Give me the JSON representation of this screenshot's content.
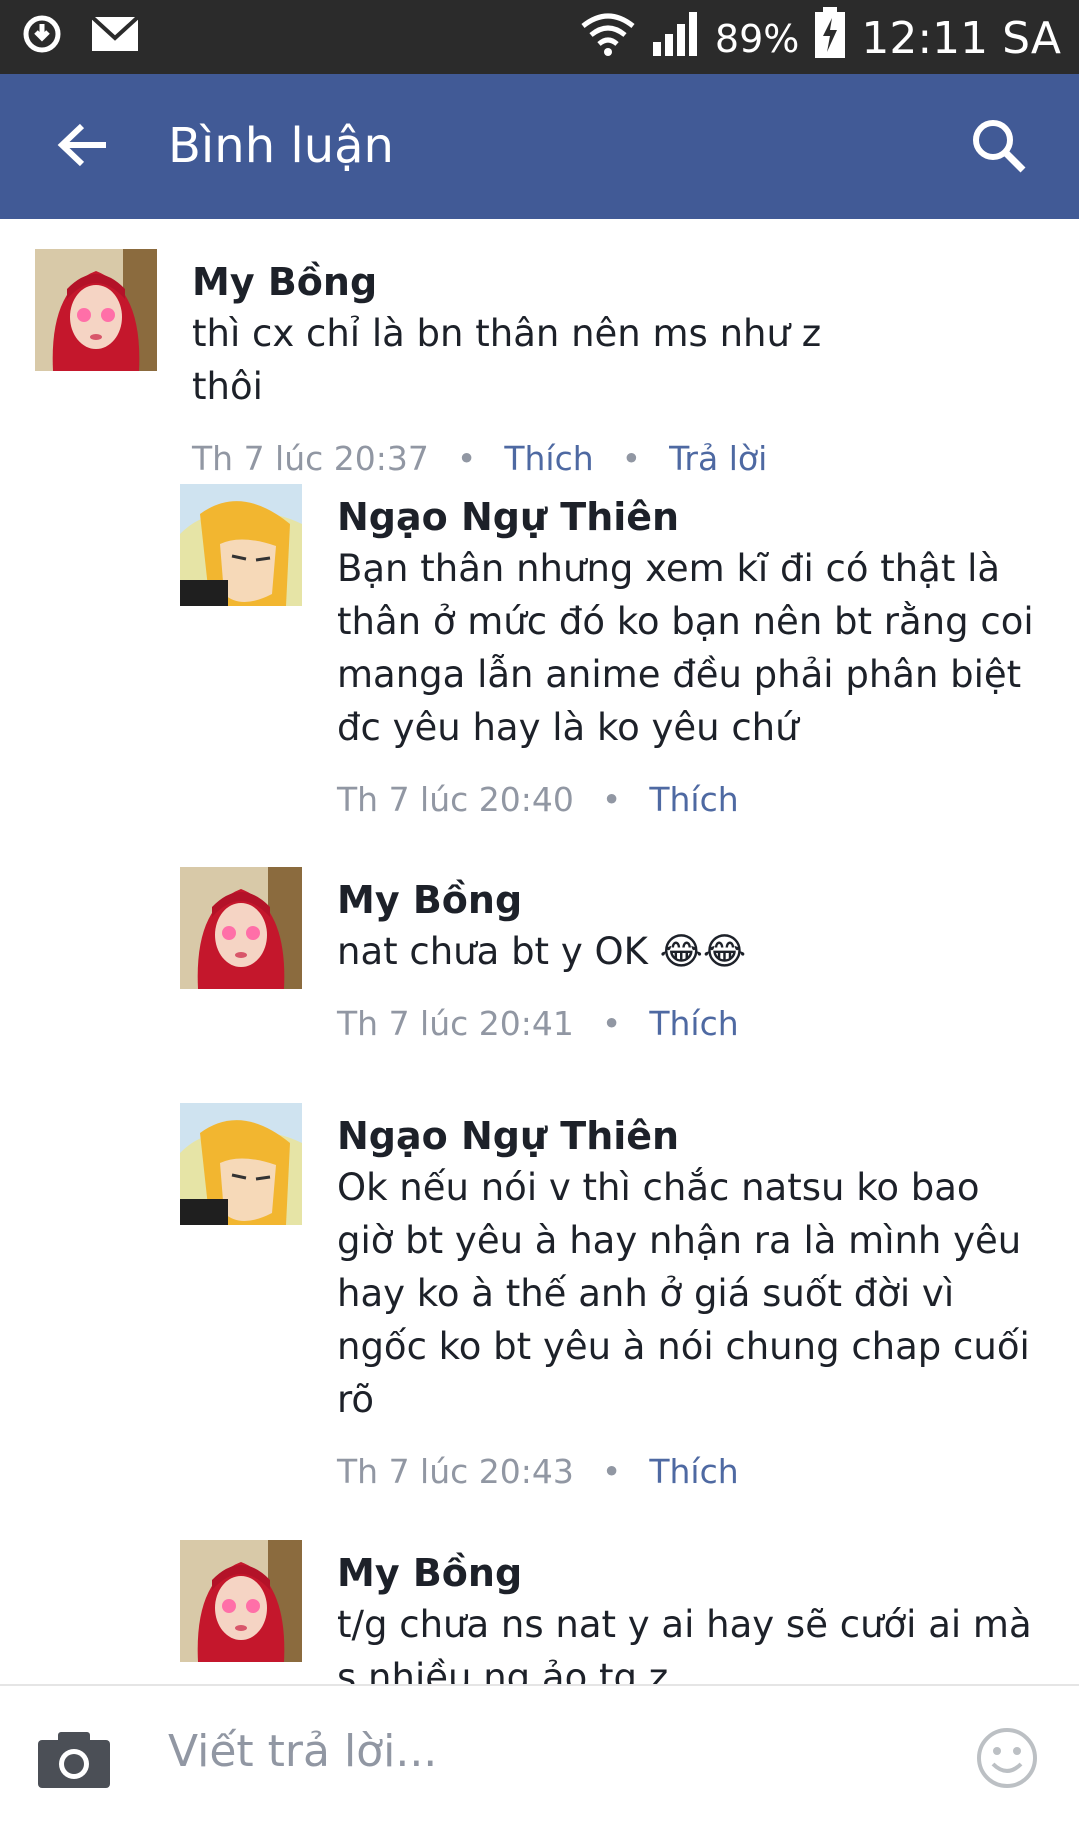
{
  "status_bar": {
    "battery": "89%",
    "time": "12:11 SA"
  },
  "app_bar": {
    "title": "Bình luận"
  },
  "comments": [
    {
      "author": "My Bồng",
      "text": "thì cx chỉ là bn thân nên ms như z thôi",
      "time": "Th 7 lúc 20:37",
      "like": "Thích",
      "reply": "Trả lời"
    },
    {
      "author": "Ngạo Ngự Thiên",
      "text": "Bạn thân nhưng xem kĩ đi có thật là thân ở mức đó ko bạn nên bt rằng coi manga lẫn anime đều phải phân biệt đc yêu hay là ko yêu chứ",
      "time": "Th 7 lúc 20:40",
      "like": "Thích"
    },
    {
      "author": "My Bồng",
      "text": "nat chưa bt y OK 😂😂",
      "time": "Th 7 lúc 20:41",
      "like": "Thích"
    },
    {
      "author": "Ngạo Ngự Thiên",
      "text": "Ok nếu nói v thì chắc natsu ko bao giờ bt yêu à hay nhận ra là mình yêu hay ko à thế anh ở giá suốt đời vì ngốc ko bt yêu à nói chung chap cuối rõ",
      "time": "Th 7 lúc 20:43",
      "like": "Thích"
    },
    {
      "author": "My Bồng",
      "text": "t/g chưa ns nat y ai hay sẽ cưới ai mà s nhiều ng ảo tg z"
    }
  ],
  "composer": {
    "placeholder": "Viết trả lời..."
  },
  "colors": {
    "header": "#415a96",
    "status_bar": "#2b2b2b",
    "link": "#4e69a2",
    "meta": "#9197a3"
  }
}
